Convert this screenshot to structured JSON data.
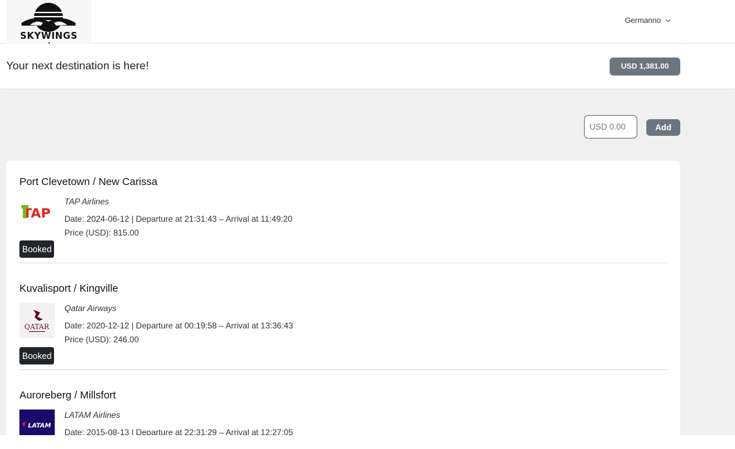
{
  "brand": {
    "logo_text": "SKYWINGS"
  },
  "user": {
    "name": "Germanno"
  },
  "header": {
    "tagline": "Your next destination is here!",
    "balance": "USD 1,381.00"
  },
  "wallet": {
    "amount_placeholder": "USD 0.00",
    "add_label": "Add"
  },
  "flights": [
    {
      "route": "Port Clevetown / New Carissa",
      "airline": "TAP Airlines",
      "schedule": "Date: 2024-06-12 | Departure at 21:31:43 – Arrival at 11:49:20",
      "price": "Price (USD): 815.00",
      "status": "Booked"
    },
    {
      "route": "Kuvalisport / Kingville",
      "airline": "Qatar Airways",
      "schedule": "Date: 2020-12-12 | Departure at 00:19:58 – Arrival at 13:36:43",
      "price": "Price (USD): 246.00",
      "status": "Booked"
    },
    {
      "route": "Auroreberg / Millsfort",
      "airline": "LATAM Airlines",
      "schedule": "Date: 2015-08-13 | Departure at 22:31:29 – Arrival at 12:27:05",
      "price": "",
      "status": ""
    }
  ],
  "airline_logos": {
    "tap": {
      "text": "TAP"
    },
    "qatar": {
      "text": "QATAR"
    },
    "latam": {
      "text": "LATAM"
    }
  },
  "colors": {
    "secondary": "#6c757d",
    "badge": "#212529",
    "background": "#f0f0f0"
  }
}
